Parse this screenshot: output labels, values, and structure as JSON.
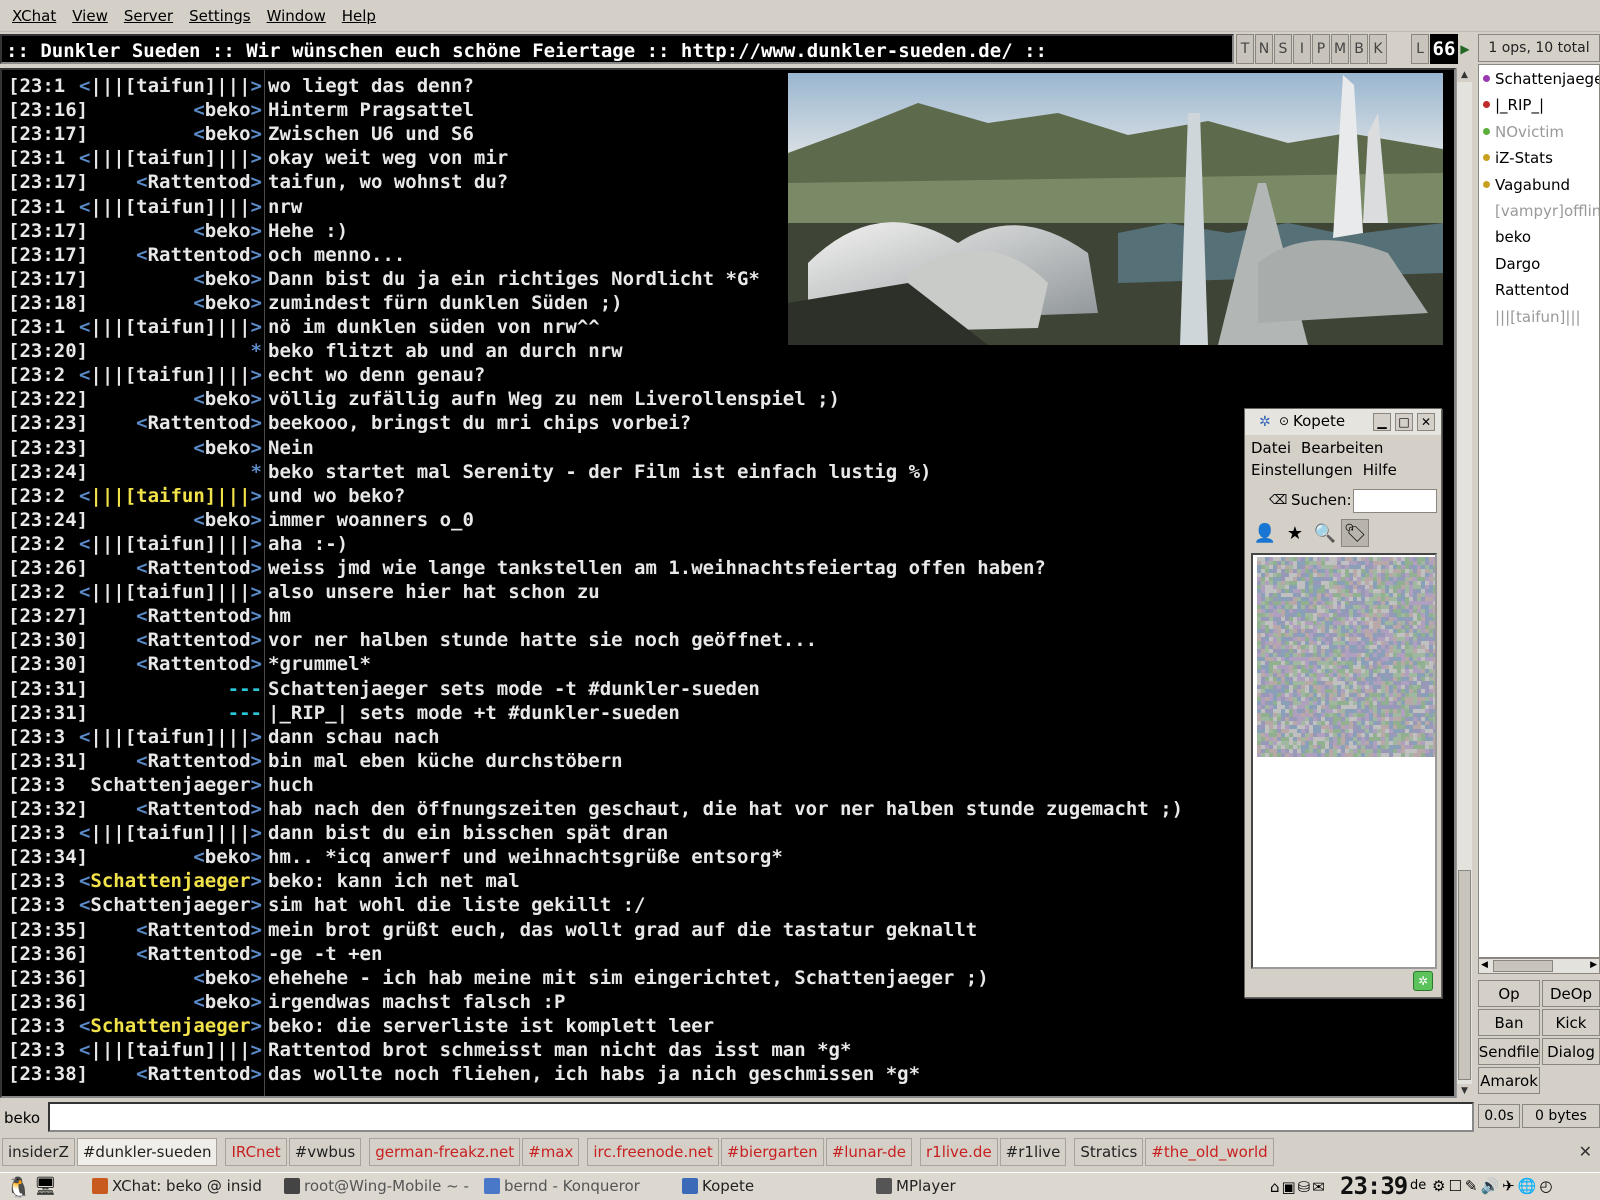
{
  "menubar": [
    "XChat",
    "View",
    "Server",
    "Settings",
    "Window",
    "Help"
  ],
  "topic": ":: Dunkler Sueden :: Wir wünschen euch schöne Feiertage :: http://www.dunkler-sueden.de/ ::",
  "modes": [
    "T",
    "N",
    "S",
    "I",
    "P",
    "M",
    "B",
    "K"
  ],
  "limit_label": "L",
  "limit_value": "66",
  "ops_count": "1 ops, 10 total",
  "messages": [
    {
      "ts": "[23:1",
      "nick": "|||[taifun]|||",
      "msg": "wo liegt das denn?",
      "style": "normal"
    },
    {
      "ts": "[23:16]",
      "nick": "beko",
      "msg": "Hinterm Pragsattel",
      "style": "normal"
    },
    {
      "ts": "[23:17]",
      "nick": "beko",
      "msg": "Zwischen U6 und S6",
      "style": "normal"
    },
    {
      "ts": "[23:1",
      "nick": "|||[taifun]|||",
      "msg": "okay weit weg von mir",
      "style": "normal"
    },
    {
      "ts": "[23:17]",
      "nick": "Rattentod",
      "msg": "taifun, wo wohnst du?",
      "style": "normal"
    },
    {
      "ts": "[23:1",
      "nick": "|||[taifun]|||",
      "msg": "nrw",
      "style": "normal"
    },
    {
      "ts": "[23:17]",
      "nick": "beko",
      "msg": "Hehe :)",
      "style": "normal"
    },
    {
      "ts": "[23:17]",
      "nick": "Rattentod",
      "msg": "och menno...",
      "style": "normal"
    },
    {
      "ts": "[23:17]",
      "nick": "beko",
      "msg": "Dann bist du ja ein richtiges Nordlicht *G*",
      "style": "normal"
    },
    {
      "ts": "[23:18]",
      "nick": "beko",
      "msg": "zumindest fürn dunklen Süden ;)",
      "style": "normal"
    },
    {
      "ts": "[23:1",
      "nick": "|||[taifun]|||",
      "msg": "nö im dunklen süden von nrw^^",
      "style": "normal"
    },
    {
      "ts": "[23:20]",
      "nick": "*",
      "msg": "beko flitzt ab und an durch nrw",
      "style": "action"
    },
    {
      "ts": "[23:2",
      "nick": "|||[taifun]|||",
      "msg": "echt wo denn genau?",
      "style": "normal"
    },
    {
      "ts": "[23:22]",
      "nick": "beko",
      "msg": "völlig zufällig aufn Weg zu nem Liverollenspiel ;)",
      "style": "normal"
    },
    {
      "ts": "[23:23]",
      "nick": "Rattentod",
      "msg": "beekooo, bringst du mri chips vorbei?",
      "style": "normal"
    },
    {
      "ts": "[23:23]",
      "nick": "beko",
      "msg": "Nein",
      "style": "normal"
    },
    {
      "ts": "[23:24]",
      "nick": "*",
      "msg": "beko startet mal Serenity - der Film ist einfach lustig %)",
      "style": "action"
    },
    {
      "ts": "[23:2",
      "nick": "|||[taifun]|||",
      "msg": "und wo beko?",
      "style": "highlight"
    },
    {
      "ts": "[23:24]",
      "nick": "beko",
      "msg": "immer woanners o_0",
      "style": "normal"
    },
    {
      "ts": "[23:2",
      "nick": "|||[taifun]|||",
      "msg": "aha :-)",
      "style": "normal"
    },
    {
      "ts": "[23:26]",
      "nick": "Rattentod",
      "msg": "weiss jmd wie lange tankstellen am 1.weihnachtsfeiertag offen haben?",
      "style": "normal"
    },
    {
      "ts": "[23:2",
      "nick": "|||[taifun]|||",
      "msg": "also unsere hier hat schon zu",
      "style": "normal"
    },
    {
      "ts": "[23:27]",
      "nick": "Rattentod",
      "msg": "hm",
      "style": "normal"
    },
    {
      "ts": "[23:30]",
      "nick": "Rattentod",
      "msg": "vor ner halben stunde hatte sie noch geöffnet...",
      "style": "normal"
    },
    {
      "ts": "[23:30]",
      "nick": "Rattentod",
      "msg": "*grummel*",
      "style": "normal"
    },
    {
      "ts": "[23:31]",
      "nick": "---",
      "msg": "Schattenjaeger sets mode -t #dunkler-sueden",
      "style": "system"
    },
    {
      "ts": "[23:31]",
      "nick": "---",
      "msg": "|_RIP_| sets mode +t #dunkler-sueden",
      "style": "system"
    },
    {
      "ts": "[23:3",
      "nick": "|||[taifun]|||",
      "msg": "dann schau nach",
      "style": "normal"
    },
    {
      "ts": "[23:31]",
      "nick": "Rattentod",
      "msg": "bin mal eben küche durchstöbern",
      "style": "normal"
    },
    {
      "ts": "[23:3",
      "nick": "Schattenjaeger",
      "msg": "huch",
      "style": "nobracket"
    },
    {
      "ts": "[23:32]",
      "nick": "Rattentod",
      "msg": "hab nach den öffnungszeiten geschaut, die hat vor ner halben stunde zugemacht ;)",
      "style": "normal"
    },
    {
      "ts": "[23:3",
      "nick": "|||[taifun]|||",
      "msg": "dann bist du ein bisschen spät dran",
      "style": "normal"
    },
    {
      "ts": "[23:34]",
      "nick": "beko",
      "msg": "hm.. *icq anwerf und weihnachtsgrüße entsorg*",
      "style": "normal"
    },
    {
      "ts": "[23:3",
      "nick": "Schattenjaeger",
      "msg": "beko: kann ich net mal",
      "style": "highlight"
    },
    {
      "ts": "[23:3",
      "nick": "Schattenjaeger",
      "msg": "sim hat wohl die liste gekillt :/",
      "style": "normal"
    },
    {
      "ts": "[23:35]",
      "nick": "Rattentod",
      "msg": "mein brot grüßt euch, das wollt grad auf die tastatur geknallt",
      "style": "normal"
    },
    {
      "ts": "[23:36]",
      "nick": "Rattentod",
      "msg": "-ge -t +en",
      "style": "normal"
    },
    {
      "ts": "[23:36]",
      "nick": "beko",
      "msg": "ehehehe - ich hab meine mit sim eingerichtet, Schattenjaeger ;)",
      "style": "normal"
    },
    {
      "ts": "[23:36]",
      "nick": "beko",
      "msg": "irgendwas machst falsch :P",
      "style": "normal"
    },
    {
      "ts": "[23:3",
      "nick": "Schattenjaeger",
      "msg": "beko: die serverliste ist komplett leer",
      "style": "highlight"
    },
    {
      "ts": "[23:3",
      "nick": "|||[taifun]|||",
      "msg": "Rattentod brot schmeisst man nicht das isst man *g*",
      "style": "normal"
    },
    {
      "ts": "[23:38]",
      "nick": "Rattentod",
      "msg": "das wollte noch fliehen, ich habs ja nich geschmissen *g*",
      "style": "normal"
    }
  ],
  "users": [
    {
      "name": "Schattenjaeger",
      "dot": "#9a3ab0",
      "away": false
    },
    {
      "name": "|_RIP_|",
      "dot": "#c02a2a",
      "away": false
    },
    {
      "name": "NOvictim",
      "dot": "#5cae3a",
      "away": true
    },
    {
      "name": "iZ-Stats",
      "dot": "#c8a020",
      "away": false
    },
    {
      "name": "Vagabund",
      "dot": "#c8a020",
      "away": false
    },
    {
      "name": "[vampyr]offline",
      "dot": "",
      "away": true
    },
    {
      "name": "beko",
      "dot": "",
      "away": false
    },
    {
      "name": "Dargo",
      "dot": "",
      "away": false
    },
    {
      "name": "Rattentod",
      "dot": "",
      "away": false
    },
    {
      "name": "|||[taifun]|||",
      "dot": "",
      "away": true
    }
  ],
  "user_buttons": [
    "Op",
    "DeOp",
    "Ban",
    "Kick",
    "Sendfile",
    "Dialog",
    "Amarok"
  ],
  "lag": "0.0s",
  "throttle": "0 bytes",
  "input_nick": "beko",
  "tabs": [
    {
      "label": "insiderZ",
      "red": false,
      "active": false
    },
    {
      "label": "#dunkler-sueden",
      "red": false,
      "active": true
    },
    {
      "gap": true
    },
    {
      "label": "IRCnet",
      "red": true,
      "active": false
    },
    {
      "label": "#vwbus",
      "red": false,
      "active": false
    },
    {
      "gap": true
    },
    {
      "label": "german-freakz.net",
      "red": true,
      "active": false
    },
    {
      "label": "#max",
      "red": true,
      "active": false
    },
    {
      "gap": true
    },
    {
      "label": "irc.freenode.net",
      "red": true,
      "active": false
    },
    {
      "label": "#biergarten",
      "red": true,
      "active": false
    },
    {
      "label": "#lunar-de",
      "red": true,
      "active": false
    },
    {
      "gap": true
    },
    {
      "label": "r1live.de",
      "red": true,
      "active": false
    },
    {
      "label": "#r1live",
      "red": false,
      "active": false
    },
    {
      "gap": true
    },
    {
      "label": "Stratics",
      "red": false,
      "active": false
    },
    {
      "label": "#the_old_world",
      "red": true,
      "active": false
    }
  ],
  "tab_close": "✕",
  "kopete": {
    "title": "Kopete",
    "menu1": [
      "Datei",
      "Bearbeiten"
    ],
    "menu2": [
      "Einstellungen",
      "Hilfe"
    ],
    "search_label": "Suchen:"
  },
  "taskbar": {
    "items": [
      {
        "label": "XChat: beko @ insid",
        "color": "#c85a20",
        "dim": false
      },
      {
        "label": "root@Wing-Mobile ~ -",
        "color": "#444",
        "dim": true
      },
      {
        "label": "bernd - Konqueror",
        "color": "#4a78c8",
        "dim": true
      },
      {
        "label": "Kopete",
        "color": "#3a6ab8",
        "dim": false
      },
      {
        "label": "MPlayer",
        "color": "#555",
        "dim": false
      }
    ],
    "clock": "23:39",
    "lang": "de"
  },
  "colors": {
    "chat_bg": "#000000",
    "chat_text": "#e8e8e8",
    "nick_bracket": "#5a8ac8",
    "highlight": "#f2e24a",
    "system": "#28c8d8",
    "tab_red": "#c82020"
  }
}
